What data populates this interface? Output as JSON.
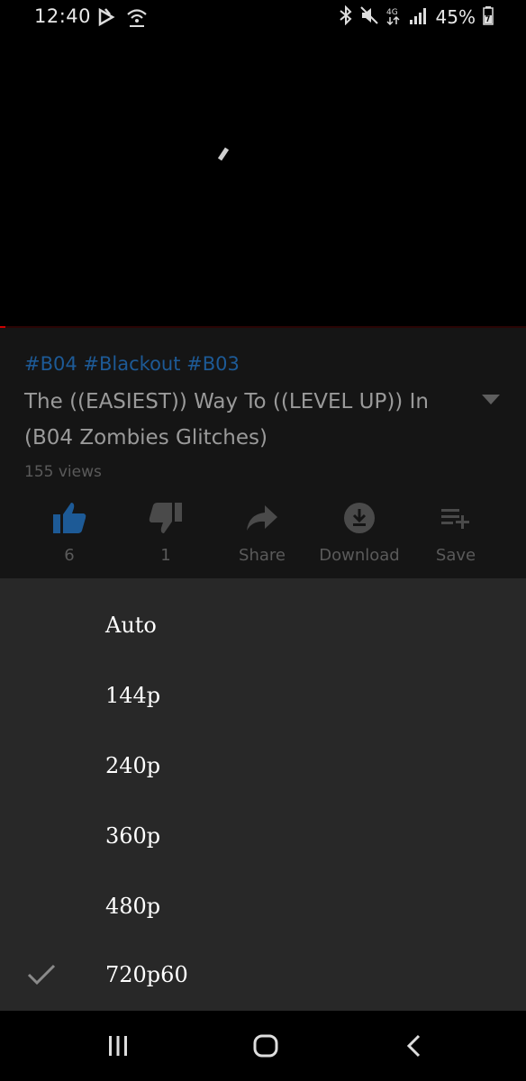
{
  "status_bar": {
    "time": "12:40",
    "battery": "45%",
    "icons": [
      "notification-icon",
      "wifi-hotspot-icon",
      "bluetooth-icon",
      "mute-icon",
      "data-4g-icon",
      "signal-icon",
      "battery-charging-icon"
    ]
  },
  "video": {
    "hashtags": "#B04 #Blackout #B03",
    "title": "The ((EASIEST)) Way To ((LEVEL UP)) In (B04 Zombies Glitches)",
    "views": "155 views"
  },
  "actions": [
    {
      "icon": "thumb-up-icon",
      "label": "6"
    },
    {
      "icon": "thumb-down-icon",
      "label": "1"
    },
    {
      "icon": "share-icon",
      "label": "Share"
    },
    {
      "icon": "download-icon",
      "label": "Download"
    },
    {
      "icon": "playlist-add-icon",
      "label": "Save"
    }
  ],
  "quality_options": [
    {
      "label": "Auto",
      "selected": false
    },
    {
      "label": "144p",
      "selected": false
    },
    {
      "label": "240p",
      "selected": false
    },
    {
      "label": "360p",
      "selected": false
    },
    {
      "label": "480p",
      "selected": false
    },
    {
      "label": "720p60",
      "selected": true
    }
  ],
  "colors": {
    "accent_blue": "#1d5a96",
    "sheet_background": "#282828",
    "progress_red": "#cc0000"
  }
}
